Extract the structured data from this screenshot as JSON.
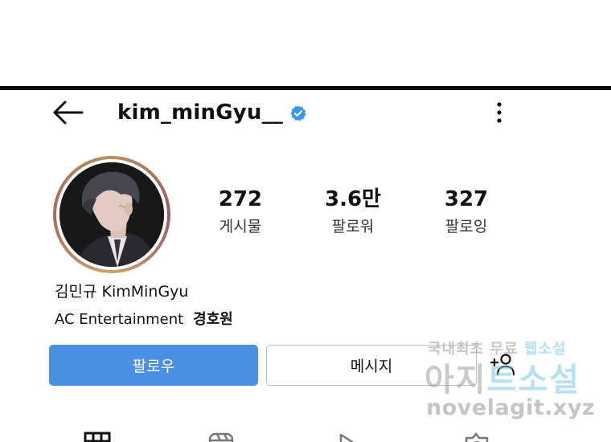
{
  "header": {
    "username": "kim_minGyu__",
    "verified": true,
    "back_icon": "back-arrow-icon",
    "more_icon": "more-vertical-icon"
  },
  "profile": {
    "avatar_icon": "avatar",
    "stats": [
      {
        "value": "272",
        "label": "게시물"
      },
      {
        "value": "3.6만",
        "label": "팔로워"
      },
      {
        "value": "327",
        "label": "팔로잉"
      }
    ],
    "display_name": "김민규 KimMinGyu",
    "bio_company": "AC Entertainment",
    "bio_extra": "경호원"
  },
  "actions": {
    "follow_label": "팔로우",
    "message_label": "메시지",
    "add_person_icon": "add-person-icon"
  },
  "tabs": [
    {
      "icon": "grid-icon"
    },
    {
      "icon": "reels-icon"
    },
    {
      "icon": "play-icon"
    },
    {
      "icon": "tagged-icon"
    }
  ],
  "watermark": {
    "line1_a": "국내최초 무료",
    "line1_b": "웹소설",
    "line2_a": "아지",
    "line2_b": "트",
    "line2_c": "소설",
    "line3": "novelagit.xyz"
  },
  "colors": {
    "follow_button": "#4a90e2",
    "verified_badge": "#3897f0",
    "panel_border": "#0b0b0b"
  }
}
